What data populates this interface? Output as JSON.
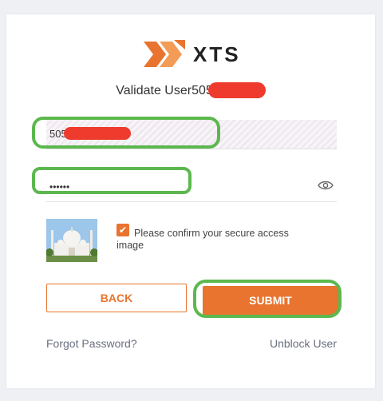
{
  "brand": {
    "name": "XTS",
    "logo_icon": "xts-logo-icon"
  },
  "title": {
    "text": "Validate User505"
  },
  "userid_field": {
    "value": "505"
  },
  "password_field": {
    "value": "••••••",
    "toggle_icon": "eye-icon"
  },
  "secure_image": {
    "icon": "taj-mahal-image"
  },
  "confirm": {
    "checked": true,
    "label": "Please confirm your secure access image"
  },
  "buttons": {
    "back": "BACK",
    "submit": "SUBMIT"
  },
  "links": {
    "forgot": "Forgot Password?",
    "unblock": "Unblock User"
  },
  "colors": {
    "accent": "#e8742f",
    "highlight": "#5cb84e",
    "redaction": "#ee3b2d"
  }
}
